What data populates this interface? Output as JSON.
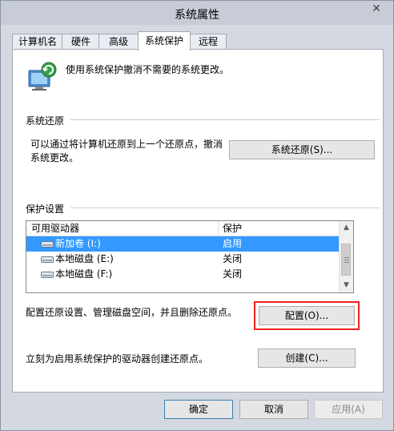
{
  "window": {
    "title": "系统属性",
    "close_glyph": "✕"
  },
  "tabs": [
    {
      "label": "计算机名"
    },
    {
      "label": "硬件"
    },
    {
      "label": "高级"
    },
    {
      "label": "系统保护"
    },
    {
      "label": "远程"
    }
  ],
  "intro": {
    "text": "使用系统保护撤消不需要的系统更改。"
  },
  "restore": {
    "title": "系统还原",
    "line1": "可以通过将计算机还原到上一个还原点，撤消",
    "line2": "系统更改。",
    "button": "系统还原(S)..."
  },
  "protection": {
    "title": "保护设置",
    "columns": [
      "可用驱动器",
      "保护"
    ],
    "rows": [
      {
        "name": "新加卷 (I:)",
        "status": "启用",
        "selected": true
      },
      {
        "name": "本地磁盘 (E:)",
        "status": "关闭",
        "selected": false
      },
      {
        "name": "本地磁盘 (F:)",
        "status": "关闭",
        "selected": false
      }
    ],
    "configure_text": "配置还原设置、管理磁盘空间，并且删除还原点。",
    "configure_button": "配置(O)...",
    "create_text": "立刻为启用系统保护的驱动器创建还原点。",
    "create_button": "创建(C)..."
  },
  "footer": {
    "ok": "确定",
    "cancel": "取消",
    "apply": "应用(A)"
  },
  "colors": {
    "selection": "#3399ff",
    "highlight_border": "#e22222",
    "window_bg": "#d4d8e0"
  }
}
